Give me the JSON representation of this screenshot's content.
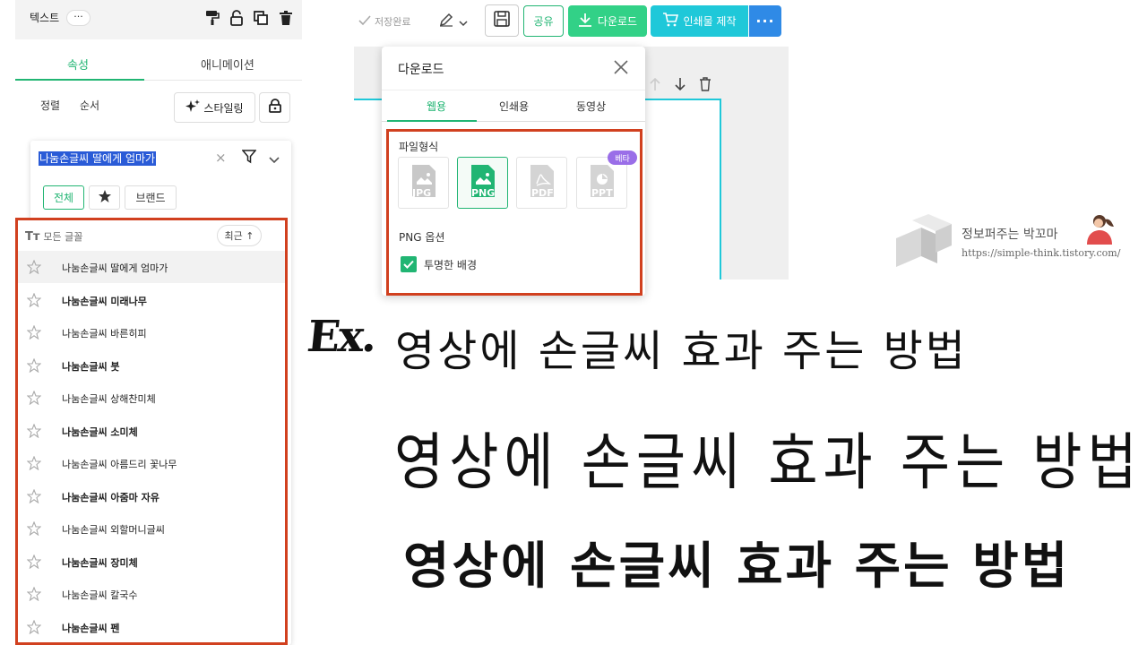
{
  "left_panel": {
    "title": "텍스트",
    "more": "···",
    "tabs": {
      "properties": "속성",
      "animation": "애니메이션"
    },
    "sort_label": "정렬",
    "order_label": "순서",
    "styling_label": "스타일링"
  },
  "font_picker": {
    "search_value": "나눔손글씨 딸에게 엄마가",
    "clear": "×",
    "chips": {
      "all": "전체",
      "brand": "브랜드"
    },
    "all_fonts_label": "모든 글꼴",
    "recent_label": "최근 ↑",
    "fonts": [
      "나눔손글씨 딸에게 엄마가",
      "나눔손글씨 미래나무",
      "나눔손글씨 바른히피",
      "나눔손글씨 붓",
      "나눔손글씨 상해찬미체",
      "나눔손글씨 소미체",
      "나눔손글씨 아름드리 꽃나무",
      "나눔손글씨 아줌마 자유",
      "나눔손글씨 외할머니글씨",
      "나눔손글씨 장미체",
      "나눔손글씨 칼국수",
      "나눔손글씨 펜"
    ]
  },
  "toolbar": {
    "saved": "저장완료",
    "share": "공유",
    "download": "다운로드",
    "print": "인쇄물 제작",
    "more": "···"
  },
  "download_popup": {
    "title": "다운로드",
    "tabs": {
      "web": "웹용",
      "print": "인쇄용",
      "video": "동영상"
    },
    "file_format_label": "파일형식",
    "formats": [
      "JPG",
      "PNG",
      "PDF",
      "PPT"
    ],
    "beta": "베타",
    "png_options_label": "PNG 옵션",
    "transparent_label": "투명한 배경",
    "transparent_checked": true
  },
  "watermark": {
    "name": "정보퍼주는 박꼬마",
    "url": "https://simple-think.tistory.com/"
  },
  "showcase": {
    "ex_label": "Ex.",
    "sample_1": "영상에 손글씨 효과 주는 방법",
    "sample_2": "영상에 손글씨 효과 주는 방법",
    "sample_3": "영상에 손글씨 효과 주는 방법"
  },
  "colors": {
    "accent_green": "#21b573",
    "download_green": "#32d187",
    "print_cyan": "#1fc8d9",
    "more_blue": "#2f8ae6",
    "highlight_red": "#d1401f",
    "beta_purple": "#9a6ee8"
  },
  "icons": [
    "paint-roller-icon",
    "unlock-icon",
    "copy-icon",
    "trash-icon",
    "sparkle-icon",
    "lock-icon",
    "filter-icon",
    "chevron-down-icon",
    "star-icon",
    "text-icon",
    "check-icon",
    "pen-icon",
    "save-icon",
    "download-icon",
    "cart-icon",
    "close-icon",
    "arrow-up-icon",
    "arrow-down-icon",
    "file-jpg-icon",
    "file-png-icon",
    "file-pdf-icon",
    "file-ppt-icon"
  ]
}
